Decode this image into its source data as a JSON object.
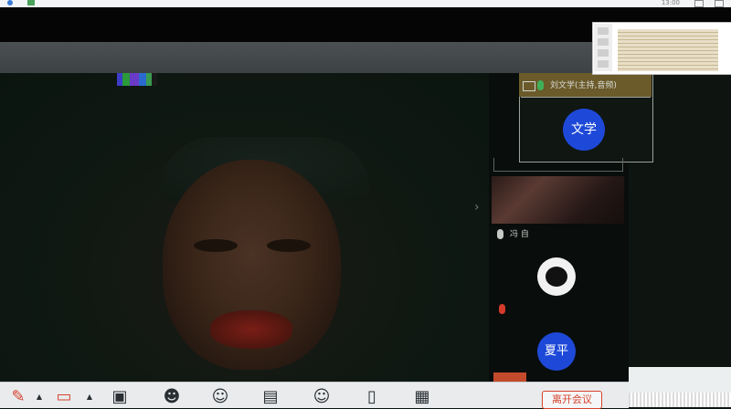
{
  "titlebar": {
    "time": "13:00"
  },
  "floating_window": {
    "participant_name": "刘文学(主持,音频)",
    "avatar_text": "文学"
  },
  "participants": [
    {
      "name": "冯 自",
      "muted": false
    },
    {
      "name": "",
      "muted": true
    },
    {
      "avatar_text": "夏平"
    }
  ],
  "toolbar": {
    "end_meeting_label": "离开会议",
    "icons": [
      "mute-icon",
      "stop-video-icon",
      "share-screen-icon",
      "participants-icon",
      "invite-icon",
      "chat-icon",
      "reactions-icon",
      "notes-icon",
      "apps-icon"
    ]
  },
  "colors": {
    "accent_blue": "#1e49d8",
    "end_red": "#d6432e",
    "mic_green": "#3fb05a",
    "toolbar_bg": "#e9ebed"
  }
}
